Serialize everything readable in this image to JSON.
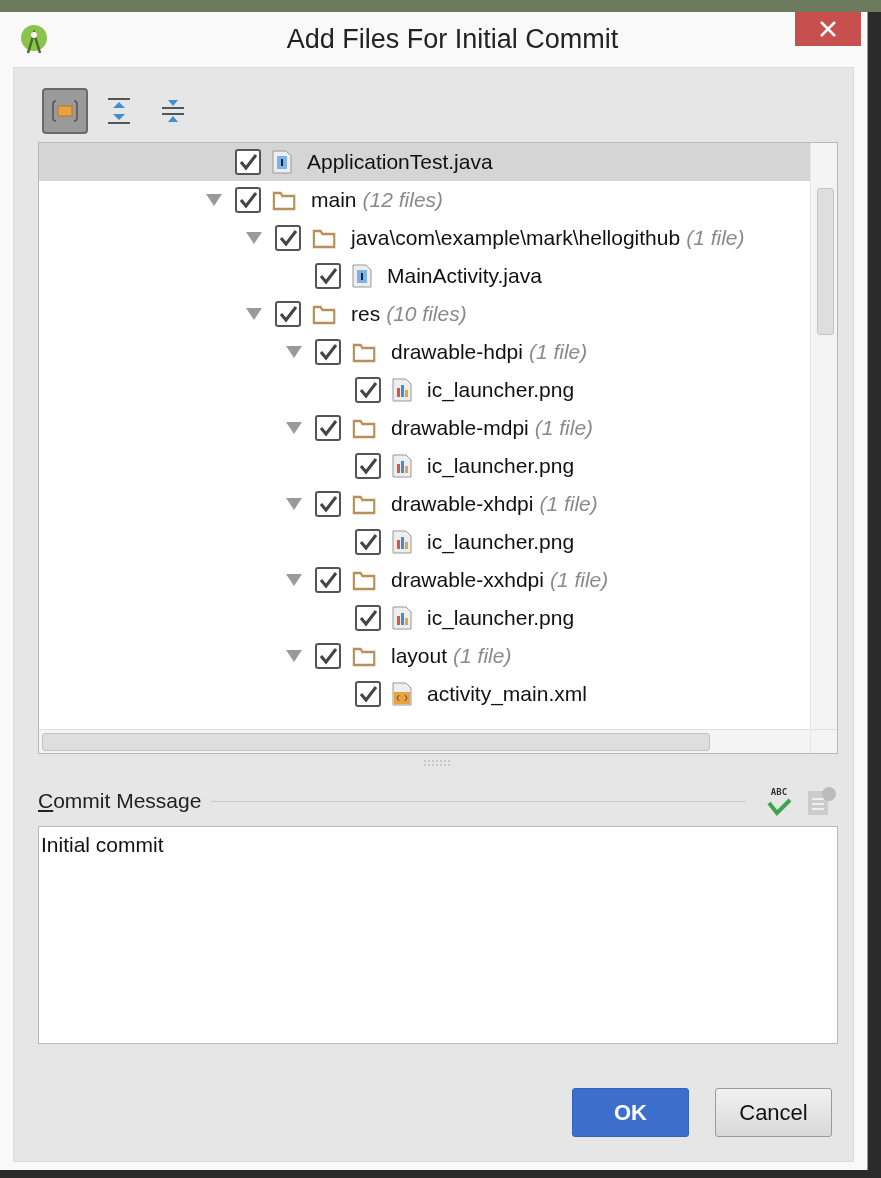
{
  "window": {
    "title": "Add Files For Initial Commit"
  },
  "toolbar": {
    "buttons": [
      {
        "kind": "group",
        "selected": true
      },
      {
        "kind": "expand",
        "selected": false
      },
      {
        "kind": "collapse",
        "selected": false
      }
    ]
  },
  "tree": {
    "items": [
      {
        "kind": "group",
        "children": [
          {
            "kind": "java",
            "name": "ApplicationTest.java",
            "checked": true,
            "selected": true
          }
        ]
      },
      {
        "kind": "folder",
        "name": "main",
        "count": "(12 files)",
        "checked": true,
        "expanded": true,
        "selected": false,
        "children": [
          {
            "kind": "folder",
            "name": "java\\com\\example\\mark\\hellogithub",
            "count": "(1 file)",
            "checked": true,
            "expanded": true,
            "selected": false,
            "children": [
              {
                "kind": "java",
                "name": "MainActivity.java",
                "checked": true,
                "selected": false
              }
            ]
          },
          {
            "kind": "folder",
            "name": "res",
            "count": "(10 files)",
            "checked": true,
            "expanded": true,
            "selected": false,
            "children": [
              {
                "kind": "folder",
                "name": "drawable-hdpi",
                "count": "(1 file)",
                "checked": true,
                "expanded": true,
                "selected": false,
                "children": [
                  {
                    "kind": "image",
                    "name": "ic_launcher.png",
                    "checked": true,
                    "selected": false
                  }
                ]
              },
              {
                "kind": "folder",
                "name": "drawable-mdpi",
                "count": "(1 file)",
                "checked": true,
                "expanded": true,
                "selected": false,
                "children": [
                  {
                    "kind": "image",
                    "name": "ic_launcher.png",
                    "checked": true,
                    "selected": false
                  }
                ]
              },
              {
                "kind": "folder",
                "name": "drawable-xhdpi",
                "count": "(1 file)",
                "checked": true,
                "expanded": true,
                "selected": false,
                "children": [
                  {
                    "kind": "image",
                    "name": "ic_launcher.png",
                    "checked": true,
                    "selected": false
                  }
                ]
              },
              {
                "kind": "folder",
                "name": "drawable-xxhdpi",
                "count": "(1 file)",
                "checked": true,
                "expanded": true,
                "selected": false,
                "children": [
                  {
                    "kind": "image",
                    "name": "ic_launcher.png",
                    "checked": true,
                    "selected": false
                  }
                ]
              },
              {
                "kind": "folder",
                "name": "layout",
                "count": "(1 file)",
                "checked": true,
                "expanded": true,
                "selected": false,
                "children": [
                  {
                    "kind": "xml",
                    "name": "activity_main.xml",
                    "checked": true,
                    "selected": false
                  }
                ]
              }
            ]
          }
        ]
      }
    ]
  },
  "commit_message": {
    "label": "Commit Message",
    "value": "Initial commit",
    "spellcheck_label": "ABC"
  },
  "buttons": [
    {
      "label": "OK",
      "kind": "primary"
    },
    {
      "label": "Cancel",
      "kind": "secondary"
    }
  ]
}
